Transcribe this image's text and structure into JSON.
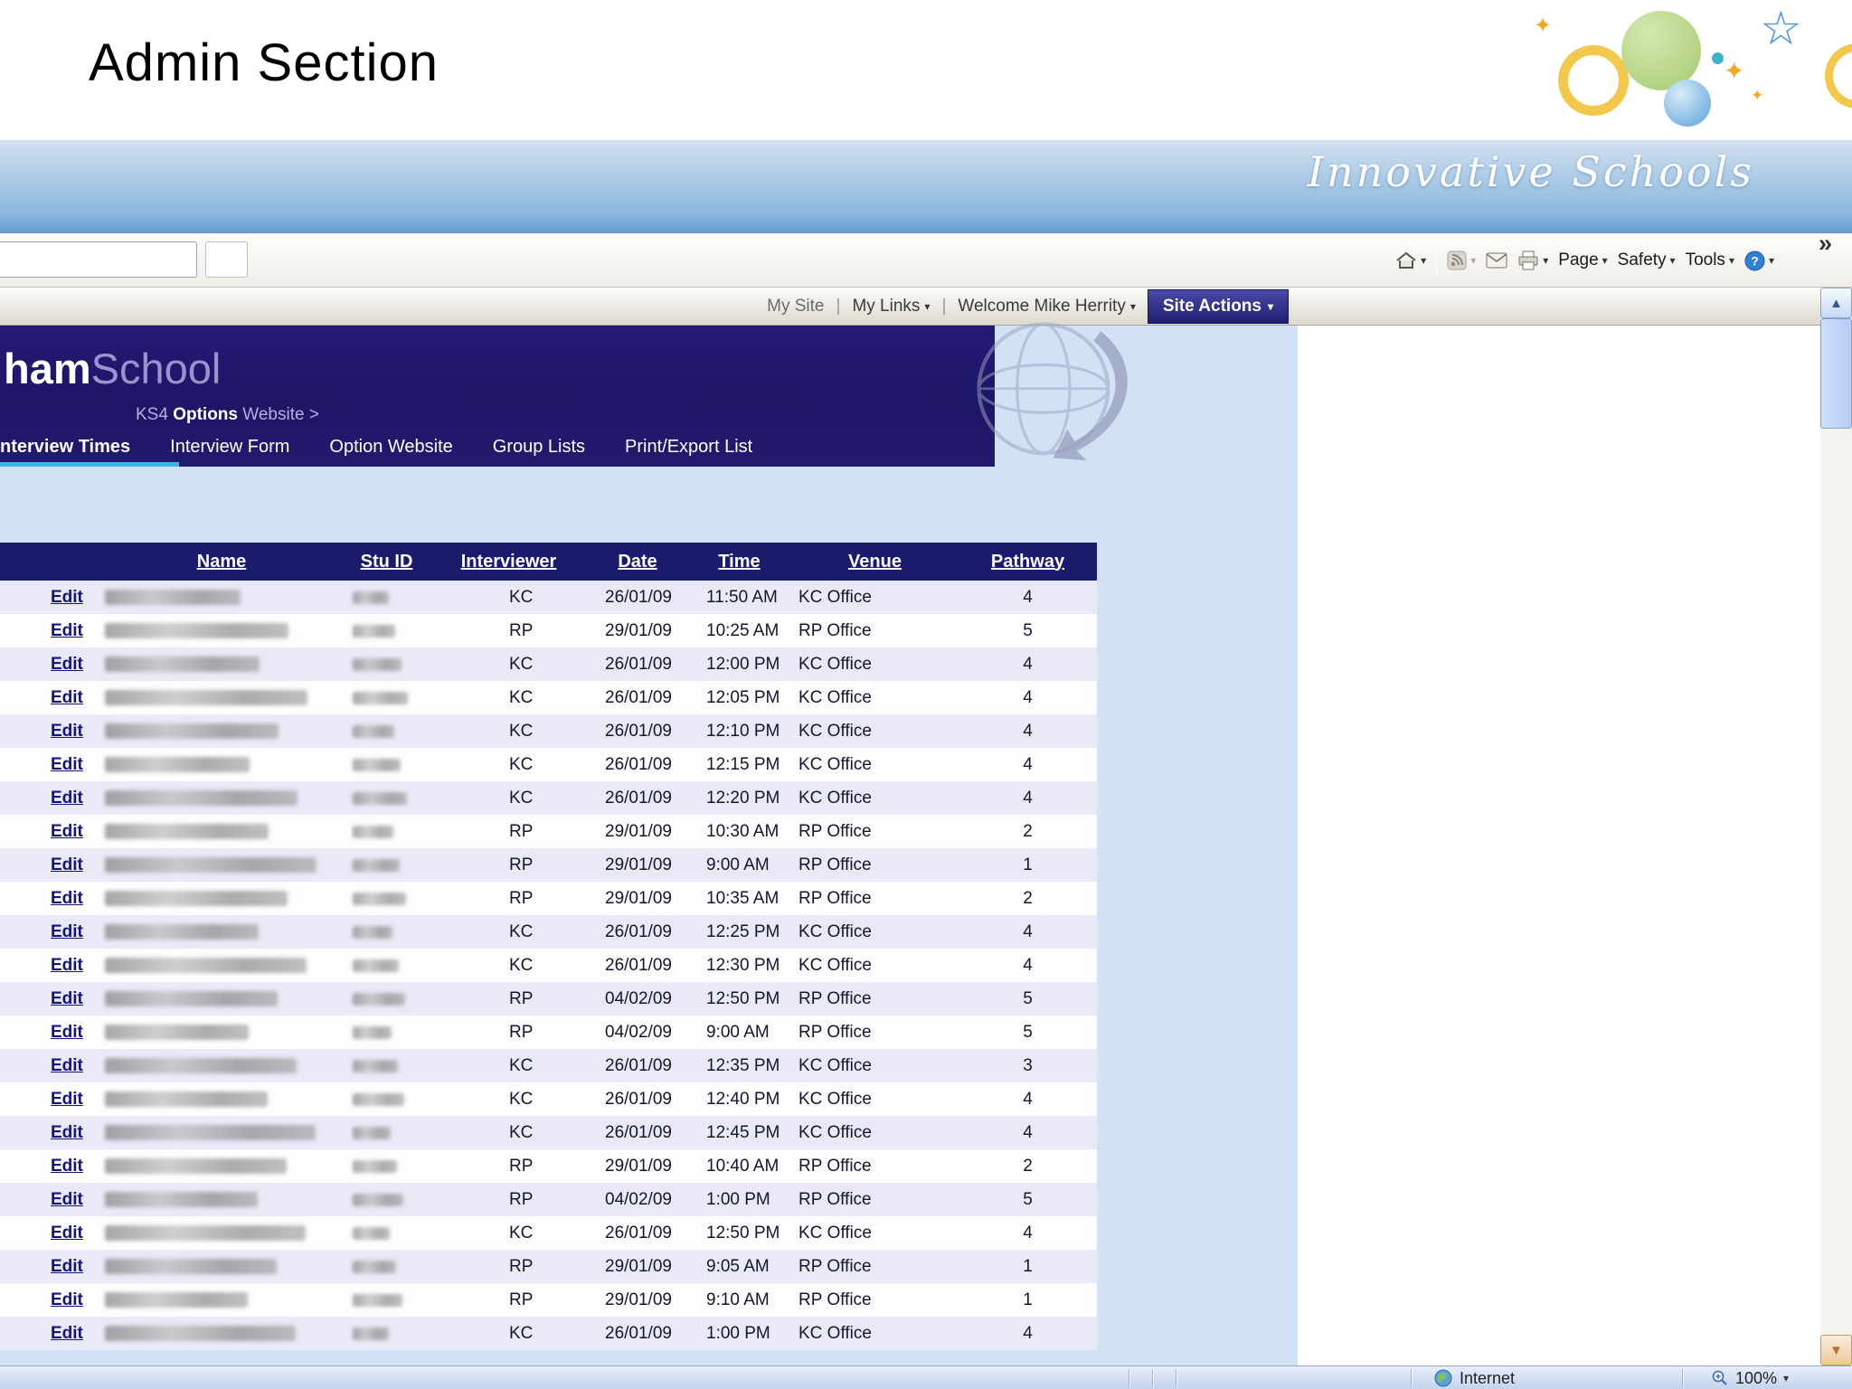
{
  "header": {
    "title": "Admin Section",
    "brand": "Innovative Schools"
  },
  "toolbar": {
    "page_label": "Page",
    "safety_label": "Safety",
    "tools_label": "Tools",
    "overflow": "»"
  },
  "portal_bar": {
    "my_site": "My Site",
    "sep": "|",
    "my_links": "My Links",
    "welcome": "Welcome Mike Herrity",
    "site_actions": "Site Actions"
  },
  "site_header": {
    "logo_bold": "ham",
    "logo_light": "School",
    "breadcrumb_prefix": "KS4 ",
    "breadcrumb_bold": "Options",
    "breadcrumb_suffix": " Website >"
  },
  "tabs": [
    {
      "label": "nterview Times",
      "active": true
    },
    {
      "label": "Interview Form",
      "active": false
    },
    {
      "label": "Option Website",
      "active": false
    },
    {
      "label": "Group Lists",
      "active": false
    },
    {
      "label": "Print/Export List",
      "active": false
    }
  ],
  "table": {
    "edit_label": "Edit",
    "columns": [
      "Name",
      "Stu ID",
      "Interviewer",
      "Date",
      "Time",
      "Venue",
      "Pathway"
    ],
    "rows": [
      {
        "interviewer": "KC",
        "date": "26/01/09",
        "time": "11:50 AM",
        "venue": "KC Office",
        "pathway": "4"
      },
      {
        "interviewer": "RP",
        "date": "29/01/09",
        "time": "10:25 AM",
        "venue": "RP Office",
        "pathway": "5"
      },
      {
        "interviewer": "KC",
        "date": "26/01/09",
        "time": "12:00 PM",
        "venue": "KC Office",
        "pathway": "4"
      },
      {
        "interviewer": "KC",
        "date": "26/01/09",
        "time": "12:05 PM",
        "venue": "KC Office",
        "pathway": "4"
      },
      {
        "interviewer": "KC",
        "date": "26/01/09",
        "time": "12:10 PM",
        "venue": "KC Office",
        "pathway": "4"
      },
      {
        "interviewer": "KC",
        "date": "26/01/09",
        "time": "12:15 PM",
        "venue": "KC Office",
        "pathway": "4"
      },
      {
        "interviewer": "KC",
        "date": "26/01/09",
        "time": "12:20 PM",
        "venue": "KC Office",
        "pathway": "4"
      },
      {
        "interviewer": "RP",
        "date": "29/01/09",
        "time": "10:30 AM",
        "venue": "RP Office",
        "pathway": "2"
      },
      {
        "interviewer": "RP",
        "date": "29/01/09",
        "time": "9:00 AM",
        "venue": "RP Office",
        "pathway": "1"
      },
      {
        "interviewer": "RP",
        "date": "29/01/09",
        "time": "10:35 AM",
        "venue": "RP Office",
        "pathway": "2"
      },
      {
        "interviewer": "KC",
        "date": "26/01/09",
        "time": "12:25 PM",
        "venue": "KC Office",
        "pathway": "4"
      },
      {
        "interviewer": "KC",
        "date": "26/01/09",
        "time": "12:30 PM",
        "venue": "KC Office",
        "pathway": "4"
      },
      {
        "interviewer": "RP",
        "date": "04/02/09",
        "time": "12:50 PM",
        "venue": "RP Office",
        "pathway": "5"
      },
      {
        "interviewer": "RP",
        "date": "04/02/09",
        "time": "9:00 AM",
        "venue": "RP Office",
        "pathway": "5"
      },
      {
        "interviewer": "KC",
        "date": "26/01/09",
        "time": "12:35 PM",
        "venue": "KC Office",
        "pathway": "3"
      },
      {
        "interviewer": "KC",
        "date": "26/01/09",
        "time": "12:40 PM",
        "venue": "KC Office",
        "pathway": "4"
      },
      {
        "interviewer": "KC",
        "date": "26/01/09",
        "time": "12:45 PM",
        "venue": "KC Office",
        "pathway": "4"
      },
      {
        "interviewer": "RP",
        "date": "29/01/09",
        "time": "10:40 AM",
        "venue": "RP Office",
        "pathway": "2"
      },
      {
        "interviewer": "RP",
        "date": "04/02/09",
        "time": "1:00 PM",
        "venue": "RP Office",
        "pathway": "5"
      },
      {
        "interviewer": "KC",
        "date": "26/01/09",
        "time": "12:50 PM",
        "venue": "KC Office",
        "pathway": "4"
      },
      {
        "interviewer": "RP",
        "date": "29/01/09",
        "time": "9:05 AM",
        "venue": "RP Office",
        "pathway": "1"
      },
      {
        "interviewer": "RP",
        "date": "29/01/09",
        "time": "9:10 AM",
        "venue": "RP Office",
        "pathway": "1"
      },
      {
        "interviewer": "KC",
        "date": "26/01/09",
        "time": "1:00 PM",
        "venue": "KC Office",
        "pathway": "4"
      }
    ]
  },
  "status_bar": {
    "zone": "Internet",
    "zoom": "100%"
  }
}
